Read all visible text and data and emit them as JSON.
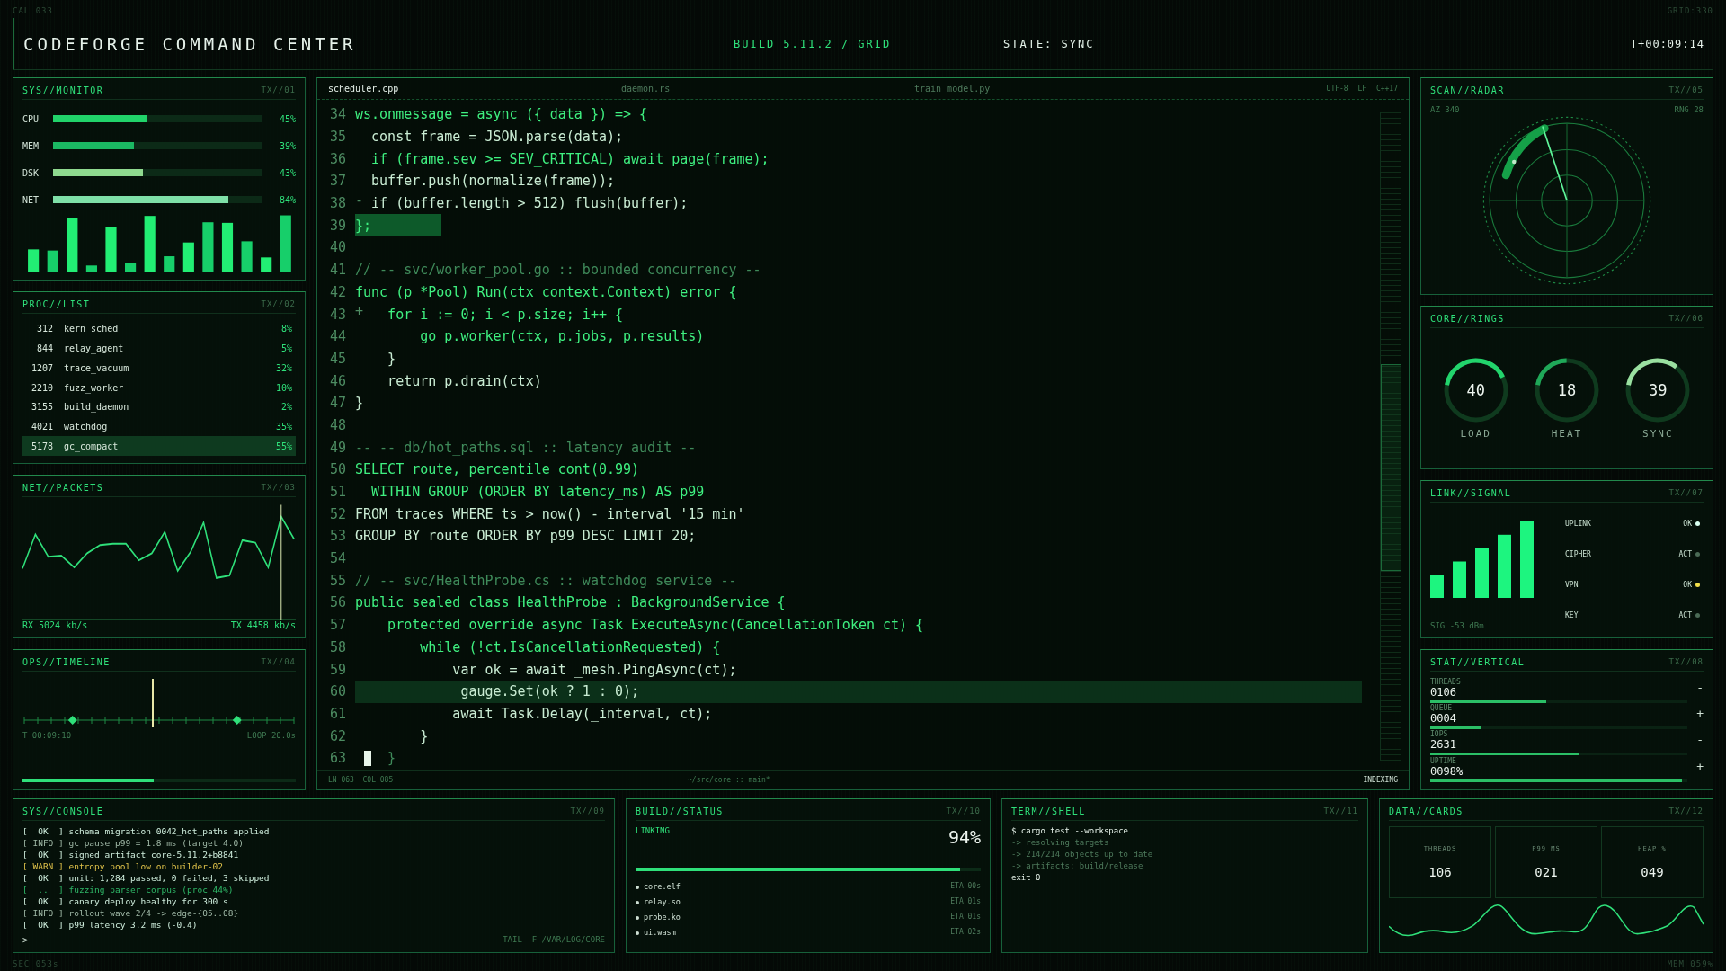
{
  "corners": {
    "top_left": "CAL 033",
    "top_right": "GRID:330",
    "bottom_left": "SEC 053s",
    "bottom_right": "MEM 059%"
  },
  "header": {
    "title": "CODEFORGE COMMAND CENTER",
    "build": "BUILD 5.11.2 / GRID",
    "state": "STATE: SYNC",
    "clock": "T+00:09:14"
  },
  "monitor": {
    "title": "SYS//MONITOR",
    "tag": "TX//01",
    "meters": [
      {
        "name": "CPU",
        "level": 0.45,
        "reading": "45%"
      },
      {
        "name": "MEM",
        "level": 0.39,
        "reading": "39%"
      },
      {
        "name": "DSK",
        "level": 0.43,
        "reading": "43%"
      },
      {
        "name": "NET",
        "level": 0.84,
        "reading": "84%"
      }
    ]
  },
  "procs": {
    "title": "PROC//LIST",
    "tag": "TX//02",
    "rows": [
      {
        "pid": "312",
        "name": "kern_sched",
        "share": "8%",
        "selected": false
      },
      {
        "pid": "844",
        "name": "relay_agent",
        "share": "5%",
        "selected": false
      },
      {
        "pid": "1207",
        "name": "trace_vacuum",
        "share": "32%",
        "selected": false
      },
      {
        "pid": "2210",
        "name": "fuzz_worker",
        "share": "10%",
        "selected": false
      },
      {
        "pid": "3155",
        "name": "build_daemon",
        "share": "2%",
        "selected": false
      },
      {
        "pid": "4021",
        "name": "watchdog",
        "share": "35%",
        "selected": false
      },
      {
        "pid": "5178",
        "name": "gc_compact",
        "share": "55%",
        "selected": true
      }
    ]
  },
  "packets": {
    "title": "NET//PACKETS",
    "tag": "TX//03",
    "rx": "RX 5024 kb/s",
    "tx": "TX 4458 kb/s"
  },
  "timeline": {
    "title": "OPS//TIMELINE",
    "tag": "TX//04",
    "start": "T 00:09:10",
    "loop": "LOOP 20.0s",
    "level": 0.48
  },
  "editor": {
    "tabs": [
      {
        "label": "scheduler.cpp",
        "selected": true
      },
      {
        "label": "daemon.rs",
        "selected": false
      },
      {
        "label": "train_model.py",
        "selected": false
      }
    ],
    "info": [
      "UTF-8",
      "LF",
      "C++17"
    ],
    "lines": [
      {
        "num": "34",
        "kind": "keyword",
        "text": "ws.onmessage = async ({ data }) => {",
        "selected": false,
        "current": false,
        "cursor": false
      },
      {
        "num": "35",
        "kind": "plain",
        "text": "  const frame = JSON.parse(data);",
        "selected": false,
        "current": false,
        "cursor": false
      },
      {
        "num": "36",
        "kind": "keyword",
        "text": "  if (frame.sev >= SEV_CRITICAL) await page(frame);",
        "selected": false,
        "current": false,
        "cursor": false
      },
      {
        "num": "37",
        "kind": "plain",
        "text": "  buffer.push(normalize(frame));",
        "selected": false,
        "current": false,
        "cursor": false
      },
      {
        "num": "38",
        "kind": "plain",
        "marker": "-",
        "text": "  if (buffer.length > 512) flush(buffer);",
        "selected": false,
        "current": false,
        "cursor": false
      },
      {
        "num": "39",
        "kind": "keyword",
        "text": "};",
        "selected": true,
        "current": false,
        "cursor": false
      },
      {
        "num": "40",
        "kind": "blank",
        "selected": false,
        "current": false,
        "cursor": false
      },
      {
        "num": "41",
        "kind": "comment",
        "text": "// -- svc/worker_pool.go :: bounded concurrency --",
        "selected": false,
        "current": false,
        "cursor": false
      },
      {
        "num": "42",
        "kind": "keyword",
        "text": "func (p *Pool) Run(ctx context.Context) error {",
        "selected": false,
        "current": false,
        "cursor": false
      },
      {
        "num": "43",
        "kind": "keyword",
        "marker": "+",
        "text": "    for i := 0; i < p.size; i++ {",
        "selected": false,
        "current": false,
        "cursor": false
      },
      {
        "num": "44",
        "kind": "keyword",
        "text": "        go p.worker(ctx, p.jobs, p.results)",
        "selected": false,
        "current": false,
        "cursor": false
      },
      {
        "num": "45",
        "kind": "plain",
        "text": "    }",
        "selected": false,
        "current": false,
        "cursor": false
      },
      {
        "num": "46",
        "kind": "plain",
        "text": "    return p.drain(ctx)",
        "selected": false,
        "current": false,
        "cursor": false
      },
      {
        "num": "47",
        "kind": "plain",
        "text": "}",
        "selected": false,
        "current": false,
        "cursor": false
      },
      {
        "num": "48",
        "kind": "blank",
        "selected": false,
        "current": false,
        "cursor": false
      },
      {
        "num": "49",
        "kind": "comment",
        "text": "-- -- db/hot_paths.sql :: latency audit --",
        "selected": false,
        "current": false,
        "cursor": false
      },
      {
        "num": "50",
        "kind": "keyword",
        "text": "SELECT route, percentile_cont(0.99)",
        "selected": false,
        "current": false,
        "cursor": false
      },
      {
        "num": "51",
        "kind": "keyword",
        "text": "  WITHIN GROUP (ORDER BY latency_ms) AS p99",
        "selected": false,
        "current": false,
        "cursor": false
      },
      {
        "num": "52",
        "kind": "plain",
        "text": "FROM traces WHERE ts > now() - interval '15 min'",
        "selected": false,
        "current": false,
        "cursor": false
      },
      {
        "num": "53",
        "kind": "plain",
        "text": "GROUP BY route ORDER BY p99 DESC LIMIT 20;",
        "selected": false,
        "current": false,
        "cursor": false
      },
      {
        "num": "54",
        "kind": "blank",
        "selected": false,
        "current": false,
        "cursor": false
      },
      {
        "num": "55",
        "kind": "comment",
        "text": "// -- svc/HealthProbe.cs :: watchdog service --",
        "selected": false,
        "current": false,
        "cursor": false
      },
      {
        "num": "56",
        "kind": "keyword",
        "text": "public sealed class HealthProbe : BackgroundService {",
        "selected": false,
        "current": false,
        "cursor": false
      },
      {
        "num": "57",
        "kind": "keyword",
        "text": "    protected override async Task ExecuteAsync(CancellationToken ct) {",
        "selected": false,
        "current": false,
        "cursor": false
      },
      {
        "num": "58",
        "kind": "keyword",
        "text": "        while (!ct.IsCancellationRequested) {",
        "selected": false,
        "current": false,
        "cursor": false
      },
      {
        "num": "59",
        "kind": "plain",
        "text": "            var ok = await _mesh.PingAsync(ct);",
        "selected": false,
        "current": false,
        "cursor": false
      },
      {
        "num": "60",
        "kind": "plain",
        "text": "            _gauge.Set(ok ? 1 : 0);",
        "selected": false,
        "current": true,
        "cursor": false
      },
      {
        "num": "61",
        "kind": "plain",
        "text": "            await Task.Delay(_interval, ct);",
        "selected": false,
        "current": false,
        "cursor": false
      },
      {
        "num": "62",
        "kind": "plain",
        "text": "        }",
        "selected": false,
        "current": false,
        "cursor": false
      },
      {
        "num": "63",
        "kind": "comment",
        "text": "    }",
        "selected": false,
        "current": false,
        "cursor": true
      }
    ],
    "status": {
      "position": "LN 063  COL 085",
      "path": "~/src/core :: main*",
      "mode": "INDEXING"
    }
  },
  "radar": {
    "title": "SCAN//RADAR",
    "tag": "TX//05",
    "azimuth": "AZ 340",
    "range": "RNG 28"
  },
  "rings": {
    "title": "CORE//RINGS",
    "tag": "TX//06",
    "items": [
      {
        "value": "40",
        "label": "LOAD"
      },
      {
        "value": "18",
        "label": "HEAT"
      },
      {
        "value": "39",
        "label": "SYNC"
      }
    ]
  },
  "link": {
    "title": "LINK//SIGNAL",
    "tag": "TX//07",
    "signal": "SIG -53 dBm",
    "rows": [
      {
        "name": "UPLINK",
        "status": "OK",
        "color": "#d8fff0"
      },
      {
        "name": "CIPHER",
        "status": "ACT",
        "color": "#4a6a55"
      },
      {
        "name": "VPN",
        "status": "OK",
        "color": "#f2e04a"
      },
      {
        "name": "KEY",
        "status": "ACT",
        "color": "#4a6a55"
      }
    ]
  },
  "stats": {
    "title": "STAT//VERTICAL",
    "tag": "TX//08",
    "rows": [
      {
        "label": "THREADS",
        "value": "0106",
        "sign": "-",
        "level": 0.45
      },
      {
        "label": "QUEUE",
        "value": "0004",
        "sign": "+",
        "level": 0.2
      },
      {
        "label": "IOPS",
        "value": "2631",
        "sign": "-",
        "level": 0.58
      },
      {
        "label": "UPTIME",
        "value": "0098%",
        "sign": "+",
        "level": 0.98
      }
    ]
  },
  "console": {
    "title": "SYS//CONSOLE",
    "tag": "TX//09",
    "footer": "TAIL -F /VAR/LOG/CORE",
    "prompt": ">",
    "lines": [
      {
        "kind": "ok",
        "tag": "[  OK  ]",
        "text": "schema migration 0042_hot_paths applied"
      },
      {
        "kind": "info",
        "tag": "[ INFO ]",
        "text": "gc pause p99 = 1.8 ms (target 4.0)"
      },
      {
        "kind": "ok",
        "tag": "[  OK  ]",
        "text": "signed artifact core-5.11.2+b8841"
      },
      {
        "kind": "warn",
        "tag": "[ WARN ]",
        "text": "entropy pool low on builder-02"
      },
      {
        "kind": "ok",
        "tag": "[  OK  ]",
        "text": "unit: 1,284 passed, 0 failed, 3 skipped"
      },
      {
        "kind": "run",
        "tag": "[  ..  ]",
        "text": "fuzzing parser corpus (proc 44%)"
      },
      {
        "kind": "ok",
        "tag": "[  OK  ]",
        "text": "canary deploy healthy for 300 s"
      },
      {
        "kind": "info",
        "tag": "[ INFO ]",
        "text": "rollout wave 2/4 -> edge-{05..08}"
      },
      {
        "kind": "ok",
        "tag": "[  OK  ]",
        "text": "p99 latency 3.2 ms (-0.4)"
      }
    ]
  },
  "build": {
    "title": "BUILD//STATUS",
    "tag": "TX//10",
    "phase": "LINKING",
    "percent": "94%",
    "level": 0.94,
    "items": [
      {
        "name": "core.elf",
        "eta": "ETA 00s"
      },
      {
        "name": "relay.so",
        "eta": "ETA 01s"
      },
      {
        "name": "probe.ko",
        "eta": "ETA 01s"
      },
      {
        "name": "ui.wasm",
        "eta": "ETA 02s"
      }
    ]
  },
  "shell": {
    "title": "TERM//SHELL",
    "tag": "TX//11",
    "lines": [
      {
        "kind": "cmd",
        "text": "$ cargo test --workspace"
      },
      {
        "kind": "out",
        "text": "-> resolving targets"
      },
      {
        "kind": "out",
        "text": "-> 214/214 objects up to date"
      },
      {
        "kind": "out",
        "text": "-> artifacts: build/release"
      },
      {
        "kind": "cmd",
        "text": "exit 0"
      }
    ]
  },
  "cards": {
    "title": "DATA//CARDS",
    "tag": "TX//12",
    "items": [
      {
        "label": "THREADS",
        "value": "106"
      },
      {
        "label": "P99 MS",
        "value": "021"
      },
      {
        "label": "HEAP %",
        "value": "049"
      }
    ]
  }
}
